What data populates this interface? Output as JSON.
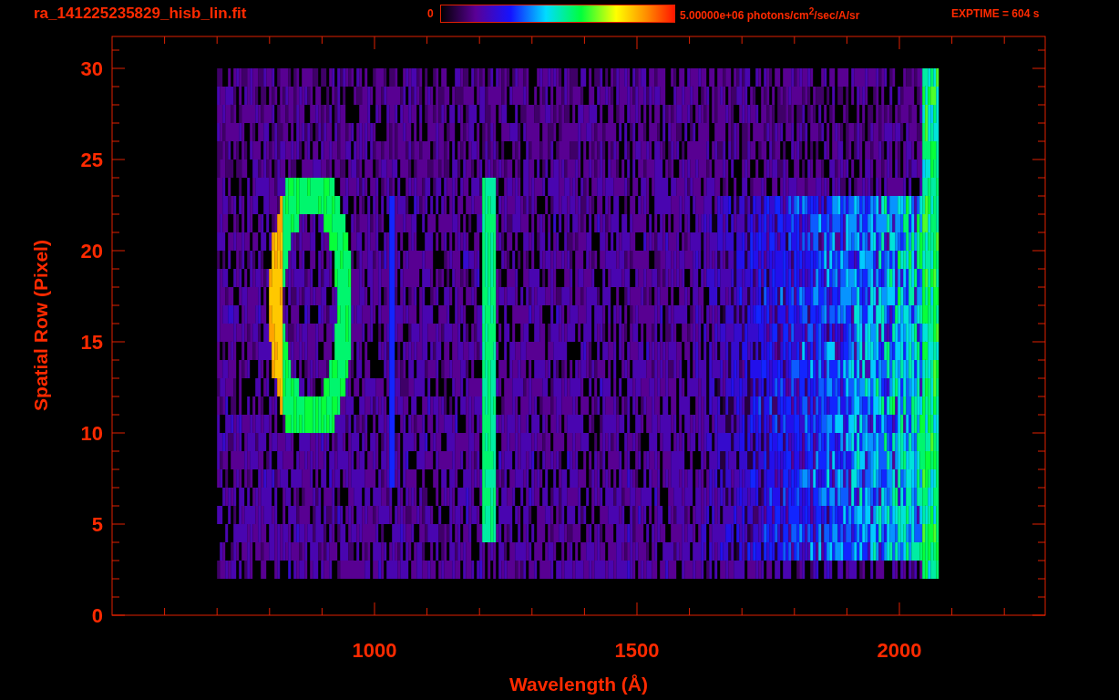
{
  "title": "ra_141225235829_hisb_lin.fit",
  "colorbar": {
    "min_label": "0",
    "max_label": "5.00000e+06 photons/cm$^{2}$/sec/A/sr"
  },
  "exptime": "EXPTIME = 604 s",
  "y_axis": {
    "label": "Spatial Row (Pixel)",
    "ticks": [
      "30",
      "25",
      "20",
      "15",
      "10",
      "5",
      "0"
    ]
  },
  "x_axis": {
    "label": "Wavelength (Å)",
    "ticks": [
      "1000",
      "1500",
      "2000"
    ]
  }
}
